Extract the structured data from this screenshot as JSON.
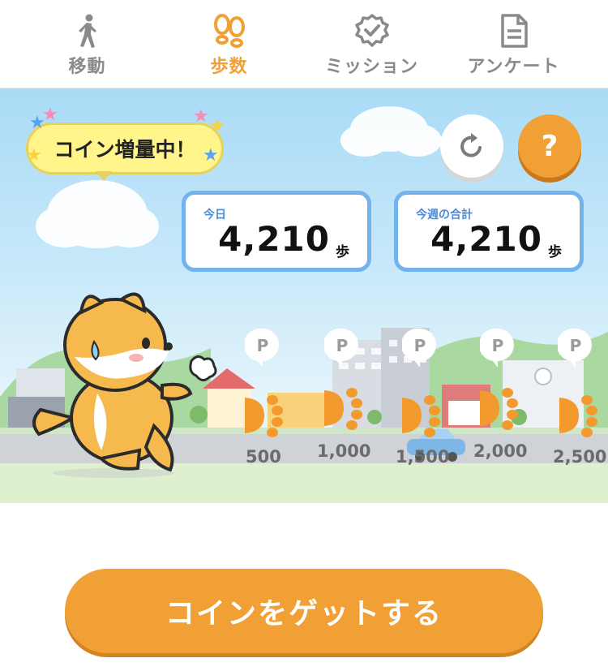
{
  "tabs": [
    {
      "label": "移動",
      "icon": "walking-person-icon",
      "active": false
    },
    {
      "label": "歩数",
      "icon": "footprints-icon",
      "active": true
    },
    {
      "label": "ミッション",
      "icon": "badge-check-icon",
      "active": false
    },
    {
      "label": "アンケート",
      "icon": "document-icon",
      "active": false
    }
  ],
  "banner": {
    "text": "コイン増量中！"
  },
  "buttons": {
    "help_label": "?",
    "refresh_icon": "refresh-icon"
  },
  "stats": {
    "today": {
      "caption": "今日",
      "value": "4,210",
      "unit": "歩"
    },
    "week": {
      "caption": "今週の合計",
      "value": "4,210",
      "unit": "歩"
    }
  },
  "milestones": [
    {
      "label": "500",
      "pin": "P"
    },
    {
      "label": "1,000",
      "pin": "P"
    },
    {
      "label": "1,500",
      "pin": "P"
    },
    {
      "label": "2,000",
      "pin": "P"
    },
    {
      "label": "2,500",
      "pin": "P"
    }
  ],
  "cta": {
    "label": "コインをゲットする"
  },
  "colors": {
    "accent": "#f0a035",
    "card_border": "#72b3ee",
    "banner": "#fff58a",
    "inactive": "#8a8a8a"
  }
}
